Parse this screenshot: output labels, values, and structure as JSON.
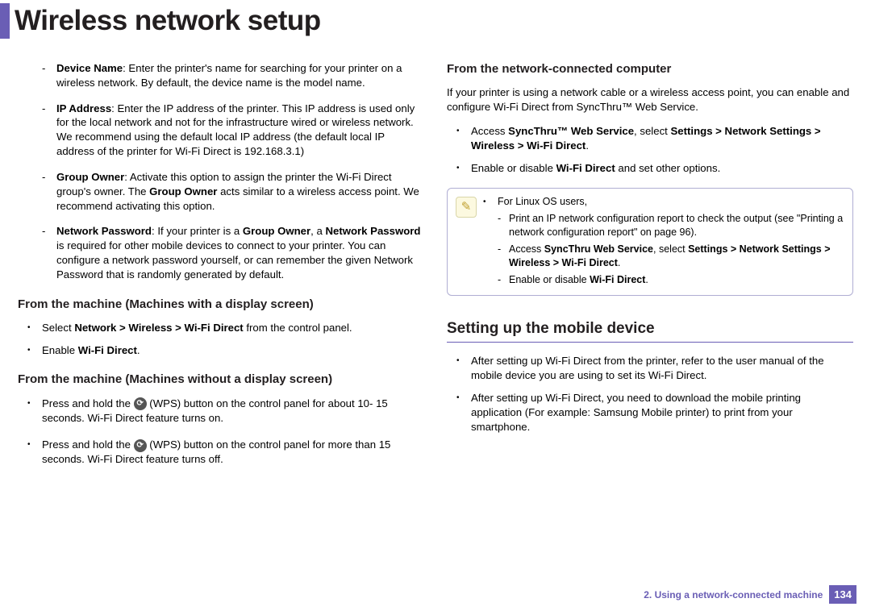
{
  "title": "Wireless network setup",
  "col1": {
    "defs": {
      "deviceName": {
        "label": "Device Name",
        "text": ": Enter the printer's name for searching for your printer on a wireless network. By default, the device name is the model name."
      },
      "ipAddress": {
        "label": "IP Address",
        "text": ": Enter the IP address of the printer. This IP address is used only for the local network and not for the infrastructure wired or wireless network. We recommend using the default local IP address (the default local IP address of the printer for Wi-Fi Direct is 192.168.3.1)"
      },
      "groupOwner": {
        "label": "Group Owner",
        "text1": ": Activate this option to assign the printer the Wi-Fi Direct group's owner. The ",
        "bold2": "Group Owner",
        "text2": " acts similar to a wireless access point. We recommend activating this option."
      },
      "netPassword": {
        "label": "Network Password",
        "text1": ": If your printer is a ",
        "bold2": "Group Owner",
        "text2": ", a ",
        "bold3": "Network Password",
        "text3": " is required for other mobile devices to connect to your printer. You can configure a network password yourself, or can remember the given Network Password that is randomly generated by default."
      }
    },
    "h3a": "From the machine (Machines with a display screen)",
    "bulletsA": {
      "b1": {
        "pre": "Select ",
        "bold": "Network > Wireless > Wi-Fi Direct",
        "post": " from the control panel."
      },
      "b2": {
        "pre": "Enable ",
        "bold": "Wi-Fi Direct",
        "post": "."
      }
    },
    "h3b": "From the machine (Machines without a display screen)",
    "bulletsB": {
      "b1": {
        "pre": "Press and hold the ",
        "post": " (WPS) button on the control panel for about 10- 15 seconds. Wi-Fi Direct feature turns on."
      },
      "b2": {
        "pre": "Press and hold the ",
        "post": " (WPS) button on the control panel for more than 15 seconds. Wi-Fi Direct feature turns off."
      }
    }
  },
  "col2": {
    "h3": "From the network-connected computer",
    "intro": "If your printer is using a network cable or a wireless access point, you can enable and configure Wi-Fi Direct from SyncThru™ Web Service.",
    "bullets": {
      "b1": {
        "pre": "Access ",
        "bold1": "SyncThru™ Web Service",
        "mid1": ", select ",
        "bold2": "Settings > Network Settings > Wireless > Wi-Fi Direct",
        "post": "."
      },
      "b2": {
        "pre": "Enable or disable ",
        "bold": "Wi-Fi Direct",
        "post": " and set other options."
      }
    },
    "note": {
      "head": "For Linux OS users,",
      "s1": "Print an IP network configuration report to check the output (see \"Printing a network configuration report\" on page 96).",
      "s2": {
        "pre": "Access ",
        "bold1": "SyncThru Web Service",
        "mid1": ", select ",
        "bold2": "Settings > Network Settings > Wireless > Wi-Fi Direct",
        "post": "."
      },
      "s3": {
        "pre": "Enable or disable ",
        "bold": "Wi-Fi Direct",
        "post": "."
      }
    },
    "h2": "Setting up the mobile device",
    "mobile": {
      "b1": "After setting up Wi-Fi Direct from the printer, refer to the user manual of the mobile device you are using to set its Wi-Fi Direct.",
      "b2": "After setting up Wi-Fi Direct, you need to download the mobile printing application (For example: Samsung Mobile printer) to print from your smartphone."
    }
  },
  "footer": {
    "chapter": "2.  Using a network-connected machine",
    "page": "134"
  }
}
